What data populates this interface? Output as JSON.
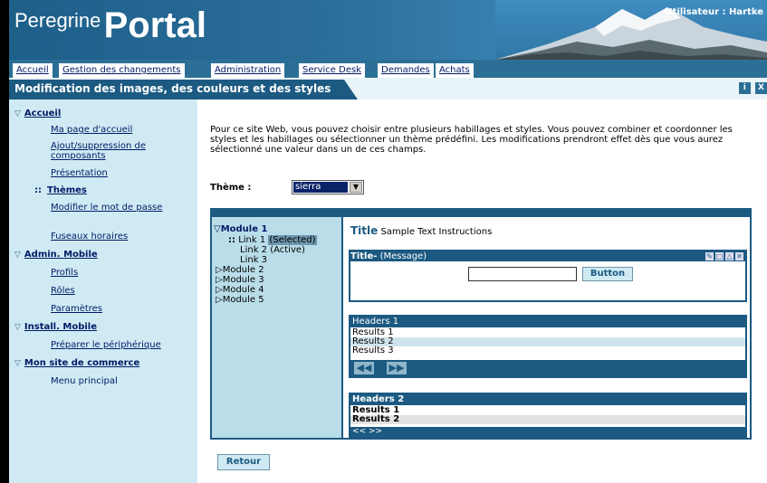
{
  "header": {
    "logo_small": "Peregrine",
    "logo_big": "Portal",
    "user_label": "Utilisateur : Hartke"
  },
  "tabs": [
    {
      "label": "Accueil"
    },
    {
      "label": "Gestion des changements"
    },
    {
      "label": "Administration"
    },
    {
      "label": "Service Desk"
    },
    {
      "label": "Demandes"
    },
    {
      "label": "Achats"
    }
  ],
  "page": {
    "title": "Modification des images, des couleurs et des styles",
    "icon_info": "i",
    "icon_close": "X"
  },
  "sidebar": {
    "sections": [
      {
        "label": "Accueil",
        "items": [
          "Ma page d'accueil",
          "Ajout/suppression de composants",
          "Présentation",
          "Thèmes",
          "Modifier le mot de passe",
          "Fuseaux horaires"
        ]
      },
      {
        "label": "Admin. Mobile",
        "items": [
          "Profils",
          "Rôles",
          "Paramètres"
        ]
      },
      {
        "label": "Install. Mobile",
        "items": [
          "Préparer le périphérique"
        ]
      },
      {
        "label": "Mon site de commerce",
        "items": [
          "Menu principal"
        ]
      }
    ]
  },
  "main": {
    "intro": "Pour ce site Web, vous pouvez choisir entre plusieurs habillages et styles. Vous pouvez combiner et coordonner les styles et les habillages ou sélectionner un thème prédéfini. Les modifications prendront effet dès que vous aurez sélectionné une valeur dans un de ces champs.",
    "theme_label": "Thème :",
    "theme_value": "sierra",
    "retour_label": "Retour"
  },
  "preview": {
    "nav": {
      "module1": "Module 1",
      "link1": "Link 1",
      "link1_state": "(Selected)",
      "link2": "Link 2 (Active)",
      "link3": "Link 3",
      "module2": "Module 2",
      "module3": "Module 3",
      "module4": "Module 4",
      "module5": "Module 5"
    },
    "title": "Title",
    "subtitle": "Sample Text Instructions",
    "message_bar_title": "Title-",
    "message_bar_msg": "(Message)",
    "button_label": "Button",
    "table1": {
      "header": "Headers 1",
      "rows": [
        "Results 1",
        "Results 2",
        "Results 3"
      ],
      "nav_prev": "◀◀",
      "nav_next": "▶▶"
    },
    "table2": {
      "header": "Headers 2",
      "rows": [
        "Results 1",
        "Results 2"
      ],
      "nav": "<< >>"
    }
  }
}
